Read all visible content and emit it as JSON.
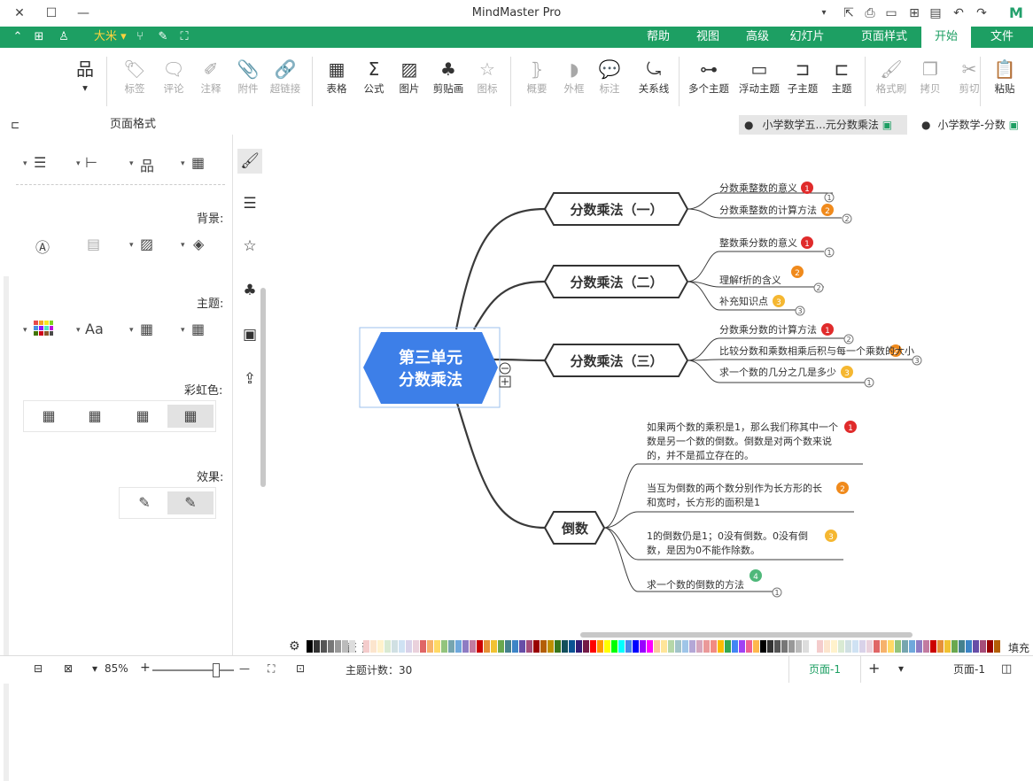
{
  "window": {
    "title": "MindMaster Pro",
    "file_menu": "文件",
    "quick_font": "大米",
    "title_icons": [
      "close-icon",
      "maximize-icon",
      "minimize-icon",
      "dropdown-icon",
      "export-icon",
      "print-icon",
      "save-icon",
      "new-icon",
      "open-icon",
      "undo-icon",
      "redo-icon"
    ]
  },
  "ribbon": {
    "tabs": [
      {
        "label": "开始",
        "active": true
      },
      {
        "label": "页面样式"
      },
      {
        "label": "幻灯片"
      },
      {
        "label": "高级"
      },
      {
        "label": "视图"
      },
      {
        "label": "帮助"
      }
    ],
    "tools": [
      {
        "label": "粘贴",
        "icon": "paste-icon"
      },
      {
        "label": "剪切",
        "icon": "cut-icon",
        "dim": true
      },
      {
        "label": "拷贝",
        "icon": "copy-icon",
        "dim": true
      },
      {
        "label": "格式刷",
        "icon": "format-painter-icon",
        "dim": true
      },
      {
        "label": "主题",
        "icon": "topic-icon"
      },
      {
        "label": "子主题",
        "icon": "subtopic-icon"
      },
      {
        "label": "浮动主题",
        "icon": "floating-topic-icon"
      },
      {
        "label": "多个主题",
        "icon": "multiple-topics-icon"
      },
      {
        "label": "关系线",
        "icon": "relationship-icon"
      },
      {
        "label": "标注",
        "icon": "callout-icon",
        "dim": true
      },
      {
        "label": "外框",
        "icon": "boundary-icon",
        "dim": true
      },
      {
        "label": "概要",
        "icon": "summary-icon",
        "dim": true
      },
      {
        "label": "图标",
        "icon": "icon-icon",
        "dim": true
      },
      {
        "label": "剪贴画",
        "icon": "clipart-icon"
      },
      {
        "label": "图片",
        "icon": "picture-icon"
      },
      {
        "label": "公式",
        "icon": "formula-icon"
      },
      {
        "label": "表格",
        "icon": "table-icon"
      },
      {
        "label": "超链接",
        "icon": "hyperlink-icon",
        "dim": true
      },
      {
        "label": "附件",
        "icon": "attachment-icon",
        "dim": true
      },
      {
        "label": "注释",
        "icon": "note-icon",
        "dim": true
      },
      {
        "label": "评论",
        "icon": "comment-icon",
        "dim": true
      },
      {
        "label": "标签",
        "icon": "tag-icon",
        "dim": true
      },
      {
        "label": "",
        "icon": "layout-icon"
      }
    ]
  },
  "docs": {
    "tabs": [
      {
        "label": "小学数学-分数"
      },
      {
        "label": "小学数学五...元分数乘法",
        "active": true
      }
    ]
  },
  "panel": {
    "title": "页面格式",
    "background_label": "背景:",
    "theme_label": "主题:",
    "rainbow_label": "彩虹色:",
    "effect_label": "效果:"
  },
  "mindmap": {
    "root": {
      "line1": "第三单元",
      "line2": "分数乘法"
    },
    "branches": [
      {
        "title": "分数乘法（一）",
        "subs": [
          {
            "num": "1",
            "text": "分数乘整数的意义"
          },
          {
            "num": "2",
            "text": "分数乘整数的计算方法"
          }
        ]
      },
      {
        "title": "分数乘法（二）",
        "subs": [
          {
            "num": "1",
            "text": "整数乘分数的意义"
          },
          {
            "num": "2",
            "text": "理解f折的含义"
          },
          {
            "num": "3",
            "text": "补充知识点"
          }
        ]
      },
      {
        "title": "分数乘法（三）",
        "subs": [
          {
            "num": "1",
            "text": "分数乘分数的计算方法"
          },
          {
            "num": "2",
            "text": "比较分数和乘数相乘后积与每一个乘数的大小"
          },
          {
            "num": "3",
            "text": "求一个数的几分之几是多少"
          }
        ]
      },
      {
        "title": "倒数",
        "subs": [
          {
            "num": "1",
            "lines": [
              "如果两个数的乘积是1，那么我们称其中一个",
              "数是另一个数的倒数。倒数是对两个数来说",
              "的，并不是孤立存在的。"
            ]
          },
          {
            "num": "2",
            "lines": [
              "当互为倒数的两个数分别作为长方形的长",
              "和宽时，长方形的面积是1"
            ]
          },
          {
            "num": "3",
            "lines": [
              "1的倒数仍是1；0没有倒数。0没有倒",
              "数，是因为0不能作除数。"
            ]
          },
          {
            "num": "4",
            "text": "求一个数的倒数的方法"
          }
        ]
      }
    ],
    "marker_counts": [
      "1",
      "2",
      "1",
      "2",
      "3",
      "2",
      "1",
      "1",
      "3",
      "1"
    ]
  },
  "palette": {
    "fill_label": "填充",
    "recent_label": "最近"
  },
  "status": {
    "page_tab": "页面-1",
    "current_page": "页面-1",
    "topic_count_label": "主题计数：",
    "topic_count": "30",
    "zoom": "85%"
  },
  "colors": {
    "brand": "#1d9f63",
    "root_blue": "#3d7fe8"
  }
}
